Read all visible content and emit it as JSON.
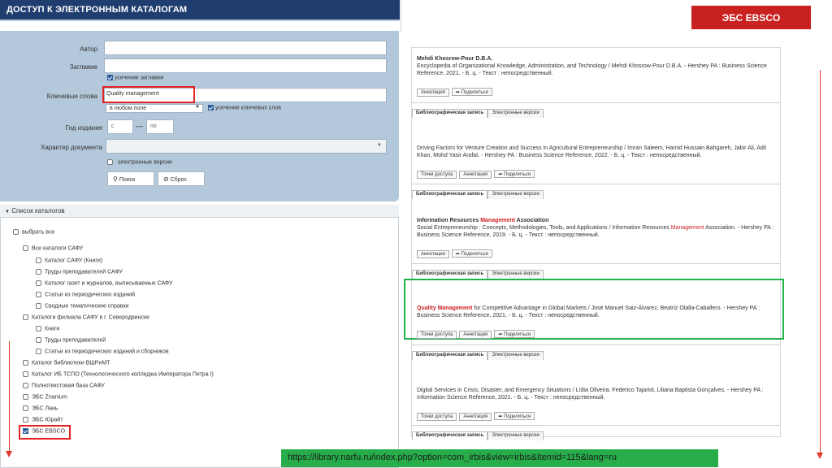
{
  "header": {
    "title": "ДОСТУП К ЭЛЕКТРОННЫМ КАТАЛОГАМ"
  },
  "badge": {
    "label": "ЭБС EBSCO"
  },
  "url_bar": {
    "text": "https://library.narfu.ru/index.php?option=com_irbis&view=irbis&Itemid=115&lang=ru"
  },
  "form": {
    "author_label": "Автор",
    "author_value": "",
    "title_label": "Заглавие",
    "title_value": "",
    "title_cut_label": "усечение заглавия",
    "keywords_label": "Ключевые слова",
    "keywords_value": "Quality management",
    "keyword_field_value": "в любом поле",
    "keyword_cut_label": "усечение ключевых слов",
    "year_label": "Год издания",
    "year_from_placeholder": "с",
    "year_dash": "—",
    "year_to_placeholder": "по",
    "doc_type_label": "Характер документа",
    "doc_type_value": "",
    "electronic_label": "электронные версии",
    "search_button": "Поиск",
    "reset_button": "Сброс"
  },
  "catalogs": {
    "heading": "Список каталогов",
    "select_all": "выбрать все",
    "items": [
      "Все каталоги САФУ",
      "Каталог САФУ (Книги)",
      "Труды преподавателей САФУ",
      "Каталог газет и журналов, выписываемых САФУ",
      "Статьи из периодических изданий",
      "Сводные тематические справки",
      "Каталоги филиала САФУ в г. Северодвинске",
      "Книги",
      "Труды преподавателей",
      "Статьи из периодических изданий и сборников",
      "Каталог библиотеки ВШРиМТ",
      "Каталог ИБ ТСПО (Технологического колледжа Императора Петра I)",
      "Полнотекстовая база САФУ",
      "ЭБС Znanium",
      "ЭБС Лань",
      "ЭБС Юрайт",
      "ЭБС EBSCO"
    ]
  },
  "results": {
    "tab_record": "Библиографическая запись",
    "tab_electronic": "Электронные версии",
    "btn_annotation": "Аннотация",
    "btn_share": "Поделиться",
    "btn_access": "Точки доступа",
    "rec1_author": "Mehdi Khosrow-Pour D.B.A.",
    "rec1_text": "Encyclopedia of Organizational Knowledge, Administration, and Technology / Mehdi Khosrow-Pour D.B.A. - Hershey PA : Business Science Reference, 2021. - Б. ц. - Текст : непосредственный.",
    "rec2_text": "Driving Factors for Venture Creation and Success in Agricultural Entrepreneurship / Imran Saleem, Hamid Hussain Bahgareh, Jabir Ali, Adil Khan, Mohd Yasir Arafat. - Hershey PA : Business Science Reference, 2022. - Б. ц. - Текст : непосредственный.",
    "rec3_author_a": "Information Resources ",
    "rec3_author_hl": "Management",
    "rec3_author_b": " Association",
    "rec3_text_a": "Social Entrepreneurship : Concepts, Methodologies, Tools, and Applications / Information Resources ",
    "rec3_text_hl": "Management",
    "rec3_text_b": " Association. - Hershey PA : Business Science Reference, 2019. - Б. ц. - Текст : непосредственный.",
    "rec4_hl1": "Quality",
    "rec4_sp": " ",
    "rec4_hl2": "Management",
    "rec4_text": " for Competitive Advantage in Global Markets / José Manuel Saiz-Álvarez, Beatriz Olalla-Caballero. - Hershey PA : Business Science Reference, 2021. - Б. ц. - Текст : непосредственный.",
    "rec5_text": "Digital Services in Crisis, Disaster, and Emergency Situations / Lídia Oliveira, Federico Tajariol, Liliana Baptista Gonçalves. - Hershey PA : Information Science Reference, 2021. - Б. ц. - Текст : непосредственный."
  },
  "colors": {
    "header_bg": "#203d6f",
    "panel_bg": "#b3c8da",
    "badge_bg": "#c8211f",
    "url_bg": "#27ae4a",
    "highlight_red": "#e42222",
    "highlight_green": "#20b24b"
  }
}
